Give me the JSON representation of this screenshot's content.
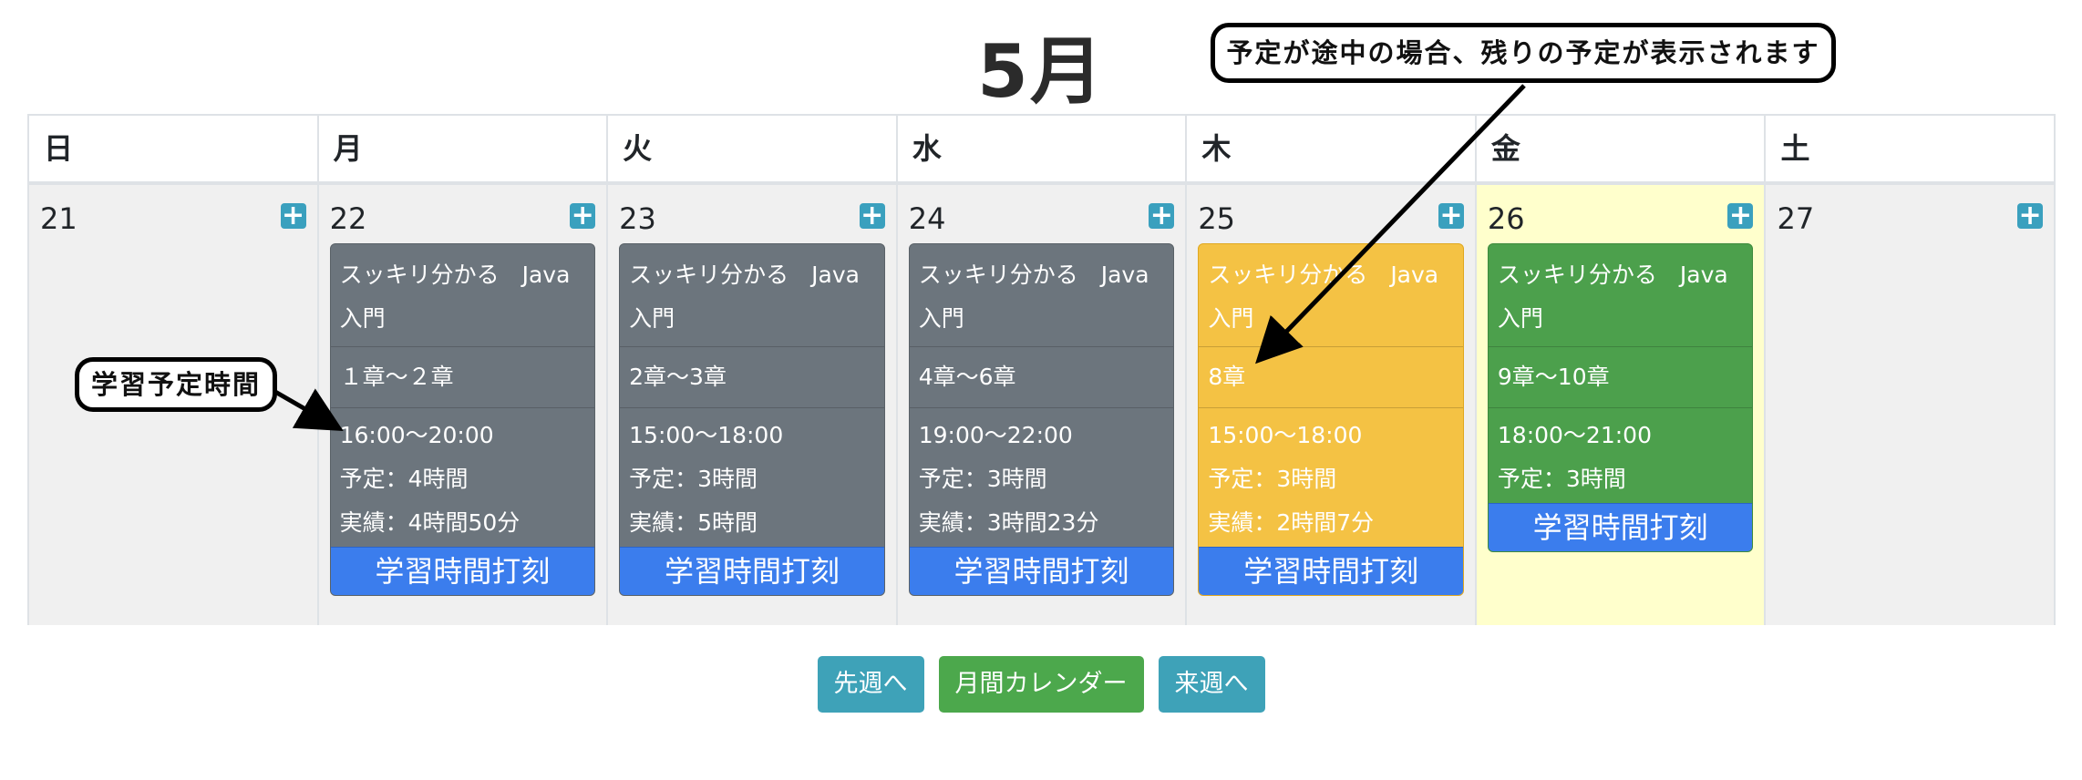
{
  "month_title": "5月",
  "weekdays": [
    "日",
    "月",
    "火",
    "水",
    "木",
    "金",
    "土"
  ],
  "days": [
    {
      "num": "21",
      "add_icon": "plus-icon"
    },
    {
      "num": "22",
      "add_icon": "plus-icon",
      "card": {
        "color": "#6c757d",
        "title": "スッキリ分かる　Java入門",
        "chapter": "１章〜２章",
        "time": "16:00〜20:00",
        "plan": "予定：4時間",
        "actual": "実績：4時間50分",
        "button": "学習時間打刻"
      }
    },
    {
      "num": "23",
      "add_icon": "plus-icon",
      "card": {
        "color": "#6c757d",
        "title": "スッキリ分かる　Java入門",
        "chapter": "2章〜3章",
        "time": "15:00〜18:00",
        "plan": "予定：3時間",
        "actual": "実績：5時間",
        "button": "学習時間打刻"
      }
    },
    {
      "num": "24",
      "add_icon": "plus-icon",
      "card": {
        "color": "#6c757d",
        "title": "スッキリ分かる　Java入門",
        "chapter": "4章〜6章",
        "time": "19:00〜22:00",
        "plan": "予定：3時間",
        "actual": "実績：3時間23分",
        "button": "学習時間打刻"
      }
    },
    {
      "num": "25",
      "add_icon": "plus-icon",
      "card": {
        "color": "#f4c244",
        "title": "スッキリ分かる　Java入門",
        "chapter": "8章",
        "time": "15:00〜18:00",
        "plan": "予定：3時間",
        "actual": "実績：2時間7分",
        "button": "学習時間打刻"
      }
    },
    {
      "num": "26",
      "add_icon": "plus-icon",
      "today": true,
      "card": {
        "color": "#4ca04c",
        "title": "スッキリ分かる　Java入門",
        "chapter": "9章〜10章",
        "time": "18:00〜21:00",
        "plan": "予定：3時間",
        "button": "学習時間打刻"
      }
    },
    {
      "num": "27",
      "add_icon": "plus-icon"
    }
  ],
  "nav": {
    "prev": "先週へ",
    "month": "月間カレンダー",
    "next": "来週へ"
  },
  "callouts": {
    "top": "予定が途中の場合、残りの予定が表示されます",
    "left": "学習予定時間"
  },
  "colors": {
    "today_bg": "#ffffcc",
    "stamp_button": "#3b7ded",
    "add_button": "#3aa0be"
  }
}
